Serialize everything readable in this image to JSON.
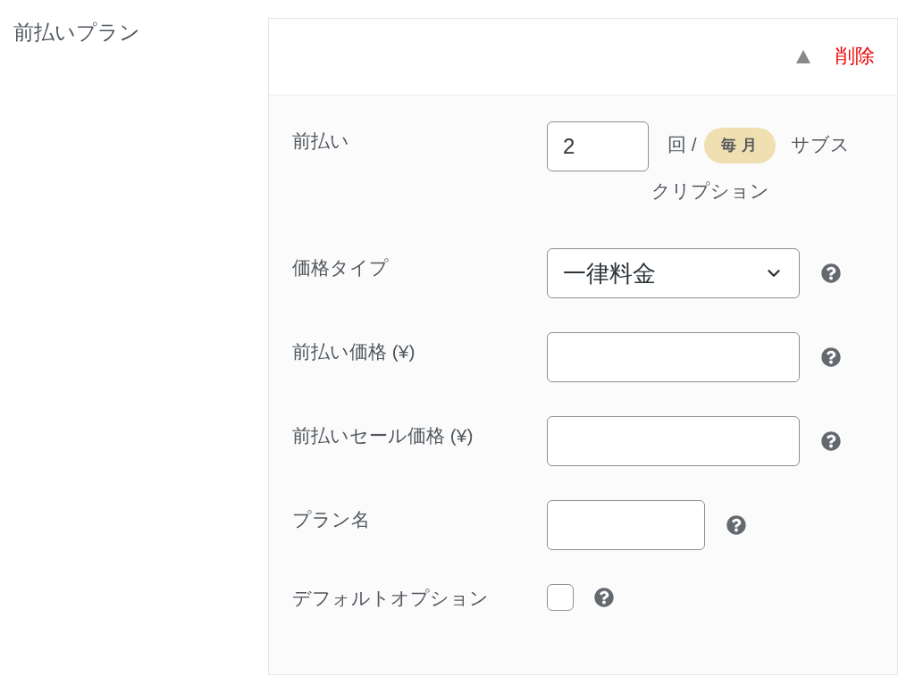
{
  "section": {
    "label": "前払いプラン"
  },
  "plan_panel": {
    "expanded": true,
    "delete_link": "削除",
    "fields": [
      {
        "kind": "count",
        "label": "前払い",
        "value": "2",
        "unit": "回 /",
        "badge": "毎月",
        "suffix": "サブスクリプション",
        "help": false
      },
      {
        "kind": "select",
        "label": "価格タイプ",
        "value": "一律料金",
        "help": true
      },
      {
        "kind": "text",
        "label": "前払い価格 (¥)",
        "help": true
      },
      {
        "kind": "text",
        "label": "前払いセール価格 (¥)",
        "help": true
      },
      {
        "kind": "short_text",
        "label": "プラン名",
        "help": true
      },
      {
        "kind": "checkbox",
        "label": "デフォルトオプション",
        "checked": false,
        "help": true
      }
    ]
  }
}
